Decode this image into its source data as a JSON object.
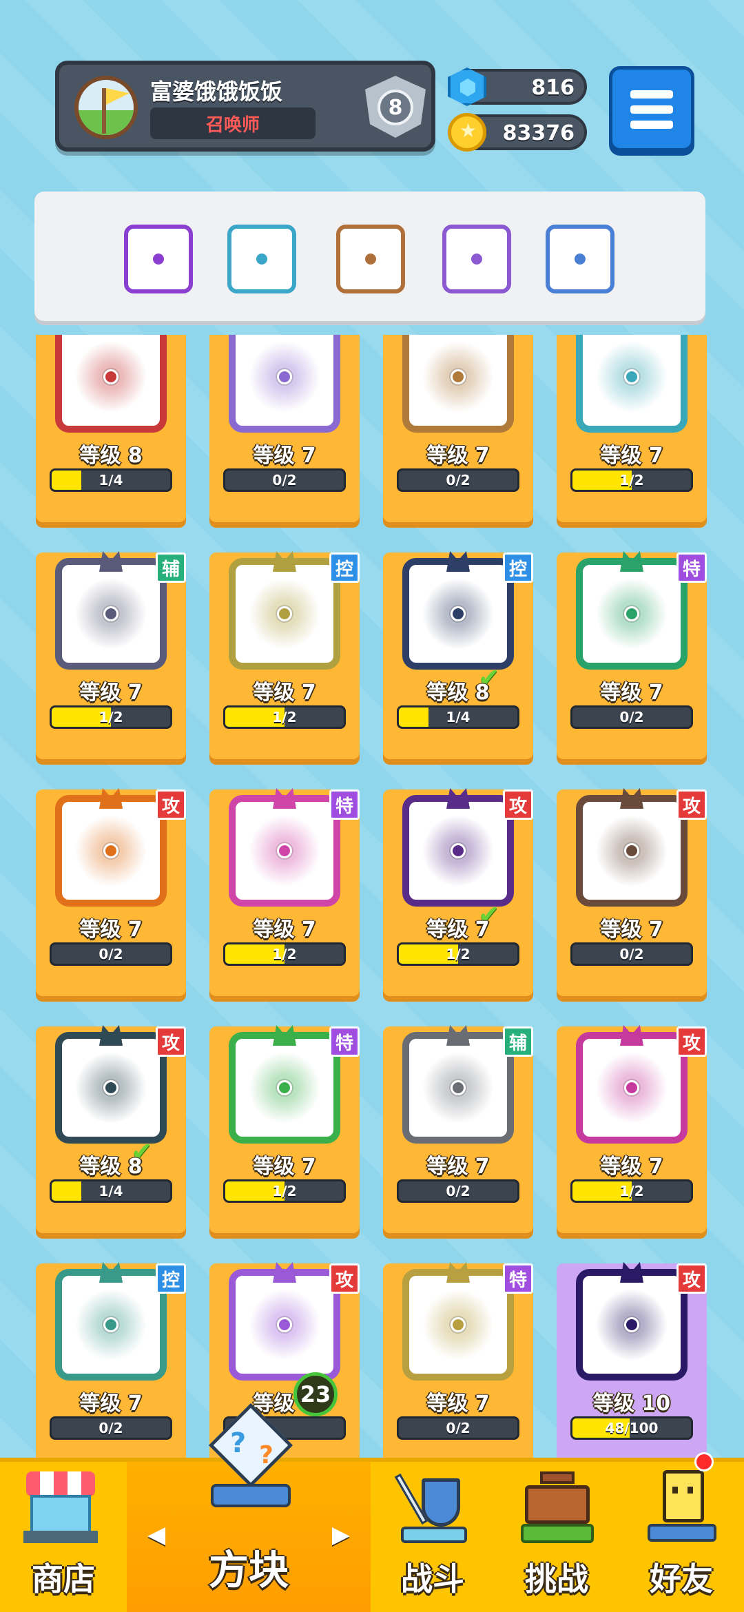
{
  "profile": {
    "name": "富婆饿饿饭饭",
    "role": "召唤师",
    "rank": "8"
  },
  "currency": {
    "gems": "816",
    "coins": "83376"
  },
  "deck": [
    {
      "color": "#8b3fd1",
      "icon": "arcane-swirl-icon"
    },
    {
      "color": "#3aa7c9",
      "icon": "vortex-icon"
    },
    {
      "color": "#b0703a",
      "icon": "question-marks-icon"
    },
    {
      "color": "#8b5ad0",
      "icon": "cracked-orb-icon"
    },
    {
      "color": "#4a7fd6",
      "icon": "snowflake-icon"
    }
  ],
  "cards": [
    {
      "level": "等级 8",
      "progress": "1/4",
      "fill": 0.25,
      "color": "#c83a3a",
      "type": "",
      "checked": false
    },
    {
      "level": "等级 7",
      "progress": "0/2",
      "fill": 0,
      "color": "#8a6ad0",
      "type": "",
      "checked": false
    },
    {
      "level": "等级 7",
      "progress": "0/2",
      "fill": 0,
      "color": "#b07a3a",
      "type": "",
      "checked": false
    },
    {
      "level": "等级 7",
      "progress": "1/2",
      "fill": 0.5,
      "color": "#3aa8b8",
      "type": "",
      "checked": false
    },
    {
      "level": "等级 7",
      "progress": "1/2",
      "fill": 0.5,
      "color": "#5a5a7a",
      "type": "辅",
      "checked": false
    },
    {
      "level": "等级 7",
      "progress": "1/2",
      "fill": 0.5,
      "color": "#b0a040",
      "type": "控",
      "checked": false
    },
    {
      "level": "等级 8",
      "progress": "1/4",
      "fill": 0.25,
      "color": "#2d3f66",
      "type": "控",
      "checked": true
    },
    {
      "level": "等级 7",
      "progress": "0/2",
      "fill": 0,
      "color": "#2aa36a",
      "type": "特",
      "checked": false
    },
    {
      "level": "等级 7",
      "progress": "0/2",
      "fill": 0,
      "color": "#e0701a",
      "type": "攻",
      "checked": false
    },
    {
      "level": "等级 7",
      "progress": "1/2",
      "fill": 0.5,
      "color": "#d046a8",
      "type": "特",
      "checked": false
    },
    {
      "level": "等级 7",
      "progress": "1/2",
      "fill": 0.5,
      "color": "#5a2c8a",
      "type": "攻",
      "checked": true
    },
    {
      "level": "等级 7",
      "progress": "0/2",
      "fill": 0,
      "color": "#6a4a3a",
      "type": "攻",
      "checked": false
    },
    {
      "level": "等级 8",
      "progress": "1/4",
      "fill": 0.25,
      "color": "#2f4a55",
      "type": "攻",
      "checked": true
    },
    {
      "level": "等级 7",
      "progress": "1/2",
      "fill": 0.5,
      "color": "#3bb04a",
      "type": "特",
      "checked": false
    },
    {
      "level": "等级 7",
      "progress": "0/2",
      "fill": 0,
      "color": "#6a6e74",
      "type": "辅",
      "checked": false
    },
    {
      "level": "等级 7",
      "progress": "1/2",
      "fill": 0.5,
      "color": "#c63a9e",
      "type": "攻",
      "checked": false
    },
    {
      "level": "等级 7",
      "progress": "0/2",
      "fill": 0,
      "color": "#3a9a8a",
      "type": "控",
      "checked": false
    },
    {
      "level": "等级 7",
      "progress": "",
      "fill": 0,
      "color": "#9a5ad8",
      "type": "攻",
      "checked": false
    },
    {
      "level": "等级 7",
      "progress": "0/2",
      "fill": 0,
      "color": "#b8a040",
      "type": "特",
      "checked": false
    },
    {
      "level": "等级 10",
      "progress": "48/100",
      "fill": 0.48,
      "color": "#2a1a66",
      "type": "攻",
      "checked": false,
      "special": true
    }
  ],
  "cube_badge": "23",
  "nav": {
    "shop": "商店",
    "cubes": "方块",
    "battle": "战斗",
    "challenge": "挑战",
    "friends": "好友"
  },
  "colors": {
    "card_bg": "#ffb836",
    "nav_bg": "#ffc400",
    "progress_fill": "#ffe500"
  }
}
